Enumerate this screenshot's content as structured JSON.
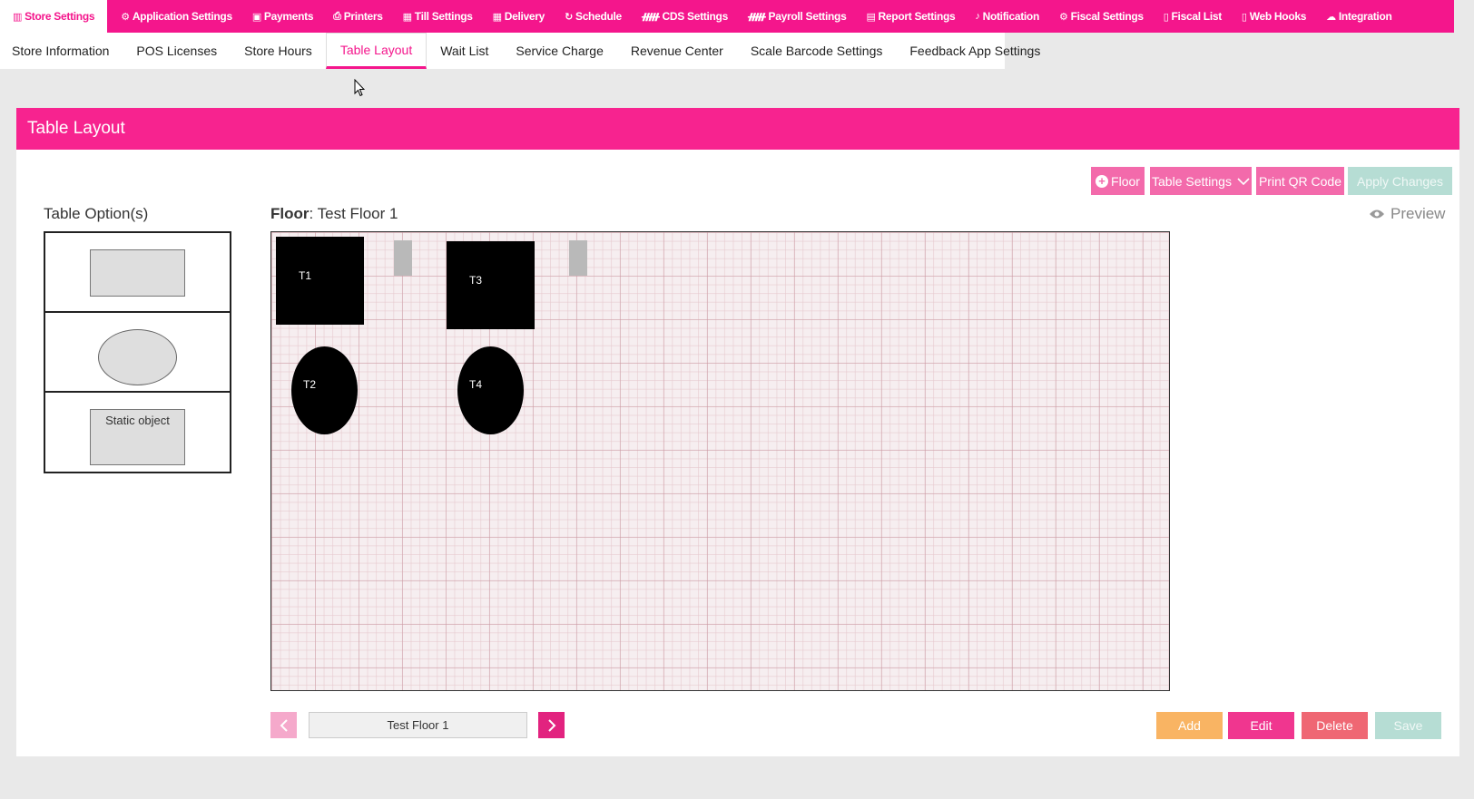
{
  "topnav": {
    "items": [
      {
        "label": "Store Settings",
        "icon": "store-icon"
      },
      {
        "label": "Application Settings",
        "icon": "gears-icon"
      },
      {
        "label": "Payments",
        "icon": "money-icon"
      },
      {
        "label": "Printers",
        "icon": "printer-icon"
      },
      {
        "label": "Till Settings",
        "icon": "calculator-icon"
      },
      {
        "label": "Delivery",
        "icon": "truck-icon"
      },
      {
        "label": "Schedule",
        "icon": "refresh-icon"
      },
      {
        "label": "CDS Settings",
        "icon": "chair-icon"
      },
      {
        "label": "Payroll Settings",
        "icon": "chair-icon"
      },
      {
        "label": "Report Settings",
        "icon": "report-icon"
      },
      {
        "label": "Notification",
        "icon": "bell-icon"
      },
      {
        "label": "Fiscal Settings",
        "icon": "gears-icon"
      },
      {
        "label": "Fiscal List",
        "icon": "file-icon"
      },
      {
        "label": "Web Hooks",
        "icon": "file-icon"
      },
      {
        "label": "Integration",
        "icon": "cloud-icon"
      }
    ]
  },
  "subnav": {
    "items": [
      "Store Information",
      "POS Licenses",
      "Store Hours",
      "Table Layout",
      "Wait List",
      "Service Charge",
      "Revenue Center",
      "Scale Barcode Settings",
      "Feedback App Settings"
    ],
    "active": "Table Layout"
  },
  "card": {
    "title": "Table Layout",
    "buttons": {
      "floor": "Floor",
      "table_settings": "Table Settings",
      "print_qr": "Print QR Code",
      "apply_changes": "Apply Changes"
    },
    "options_label": "Table Option(s)",
    "floor_prefix": "Floor",
    "floor_name": ": Test Floor 1",
    "preview": "Preview",
    "static_object_label": "Static object",
    "tables": [
      "T1",
      "T2",
      "T3",
      "T4"
    ],
    "pager_value": "Test Floor 1",
    "actions": {
      "add": "Add",
      "edit": "Edit",
      "delete": "Delete",
      "save": "Save"
    }
  },
  "colors": {
    "brand_pink": "#f4168c",
    "add": "#f9b463",
    "edit": "#f0368f",
    "delete": "#ef6773",
    "save_disabled": "#b6ddd4"
  }
}
